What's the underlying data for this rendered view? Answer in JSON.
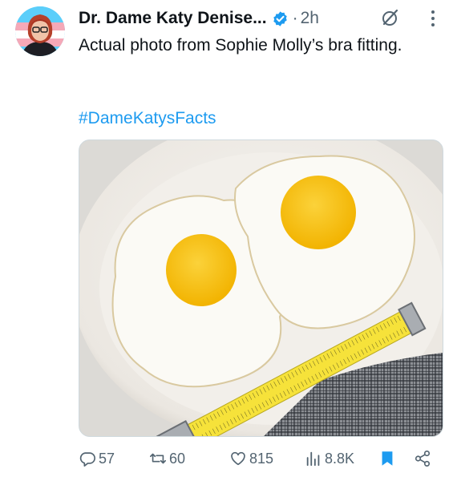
{
  "post": {
    "author_name": "Dr. Dame Katy Denise...",
    "separator": "·",
    "time": "2h",
    "text": "Actual photo from Sophie Molly’s bra fitting.",
    "hashtag": "#DameKatysFacts"
  },
  "icons": {
    "verified": "verified-badge-icon",
    "grok": "grok-icon",
    "more": "more-icon",
    "reply": "reply-icon",
    "repost": "repost-icon",
    "like": "like-icon",
    "views": "views-icon",
    "bookmark": "bookmark-icon",
    "share": "share-icon"
  },
  "actions": {
    "replies": "57",
    "reposts": "60",
    "likes": "815",
    "views": "8.8K"
  },
  "colors": {
    "accent": "#1d9bf0",
    "muted": "#536471",
    "text": "#0f1419"
  }
}
